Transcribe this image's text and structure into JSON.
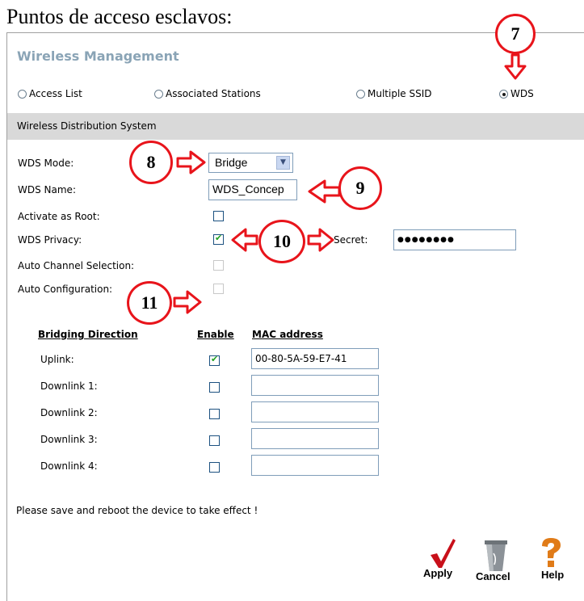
{
  "heading": "Puntos de acceso esclavos:",
  "panel_title": "Wireless Management",
  "tabs": [
    {
      "label": "Access List",
      "selected": false
    },
    {
      "label": "Associated Stations",
      "selected": false
    },
    {
      "label": "Multiple SSID",
      "selected": false
    },
    {
      "label": "WDS",
      "selected": true
    }
  ],
  "section_title": "Wireless Distribution System",
  "form": {
    "mode_label": "WDS Mode:",
    "mode_value": "Bridge",
    "name_label": "WDS Name:",
    "name_value": "WDS_Concep",
    "root_label": "Activate as Root:",
    "privacy_label": "WDS Privacy:",
    "secret_label": "Secret:",
    "secret_value": "●●●●●●●●",
    "auto_channel_label": "Auto Channel Selection:",
    "auto_config_label": "Auto Configuration:"
  },
  "bridging": {
    "headers": [
      "Bridging Direction",
      "Enable",
      "MAC address"
    ],
    "rows": [
      {
        "label": "Uplink:",
        "enabled": true,
        "mac": "00-80-5A-59-E7-41"
      },
      {
        "label": "Downlink 1:",
        "enabled": false,
        "mac": ""
      },
      {
        "label": "Downlink 2:",
        "enabled": false,
        "mac": ""
      },
      {
        "label": "Downlink 3:",
        "enabled": false,
        "mac": ""
      },
      {
        "label": "Downlink 4:",
        "enabled": false,
        "mac": ""
      }
    ]
  },
  "note": "Please save and reboot the device to take effect !",
  "buttons": {
    "apply": "Apply",
    "cancel": "Cancel",
    "help": "Help"
  },
  "callouts": [
    "7",
    "8",
    "9",
    "10",
    "11"
  ],
  "colors": {
    "callout": "#e8141b",
    "title": "#8aa4b6",
    "section_bar": "#d9d9d9"
  }
}
